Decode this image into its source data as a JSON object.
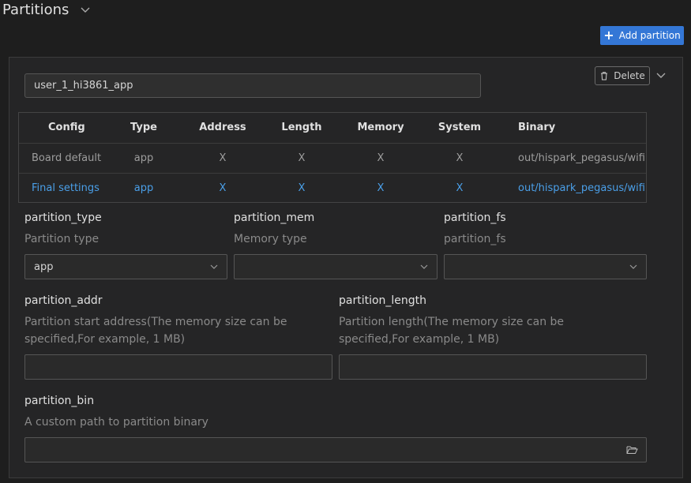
{
  "header": {
    "title": "Partitions"
  },
  "toolbar": {
    "add_label": "Add partition"
  },
  "partition": {
    "name_value": "user_1_hi3861_app",
    "delete_label": "Delete"
  },
  "table": {
    "headers": [
      "Config",
      "Type",
      "Address",
      "Length",
      "Memory",
      "System",
      "Binary"
    ],
    "rows": [
      {
        "config": "Board default",
        "type": "app",
        "address": "X",
        "length": "X",
        "memory": "X",
        "system": "X",
        "binary": "out/hispark_pegasus/wifiiot_hispark_"
      },
      {
        "config": "Final settings",
        "type": "app",
        "address": "X",
        "length": "X",
        "memory": "X",
        "system": "X",
        "binary": "out/hispark_pegasus/wifiiot_hispark_"
      }
    ]
  },
  "fields": {
    "partition_type": {
      "label": "partition_type",
      "desc": "Partition type",
      "value": "app"
    },
    "partition_mem": {
      "label": "partition_mem",
      "desc": "Memory type",
      "value": ""
    },
    "partition_fs": {
      "label": "partition_fs",
      "desc": "partition_fs",
      "value": ""
    },
    "partition_addr": {
      "label": "partition_addr",
      "desc": "Partition start address(The memory size can be specified,For example, 1 MB)",
      "value": ""
    },
    "partition_length": {
      "label": "partition_length",
      "desc": "Partition length(The memory size can be specified,For example, 1 MB)",
      "value": ""
    },
    "partition_bin": {
      "label": "partition_bin",
      "desc": "A custom path to partition binary",
      "value": ""
    }
  },
  "colors": {
    "accent": "#3477d6",
    "link": "#4a9fe8",
    "background": "#1e1e1e",
    "card": "#252526"
  },
  "icons": {
    "collapse": "chevron-down-icon",
    "add": "plus-icon",
    "delete": "trash-icon",
    "browse": "folder-open-icon"
  }
}
